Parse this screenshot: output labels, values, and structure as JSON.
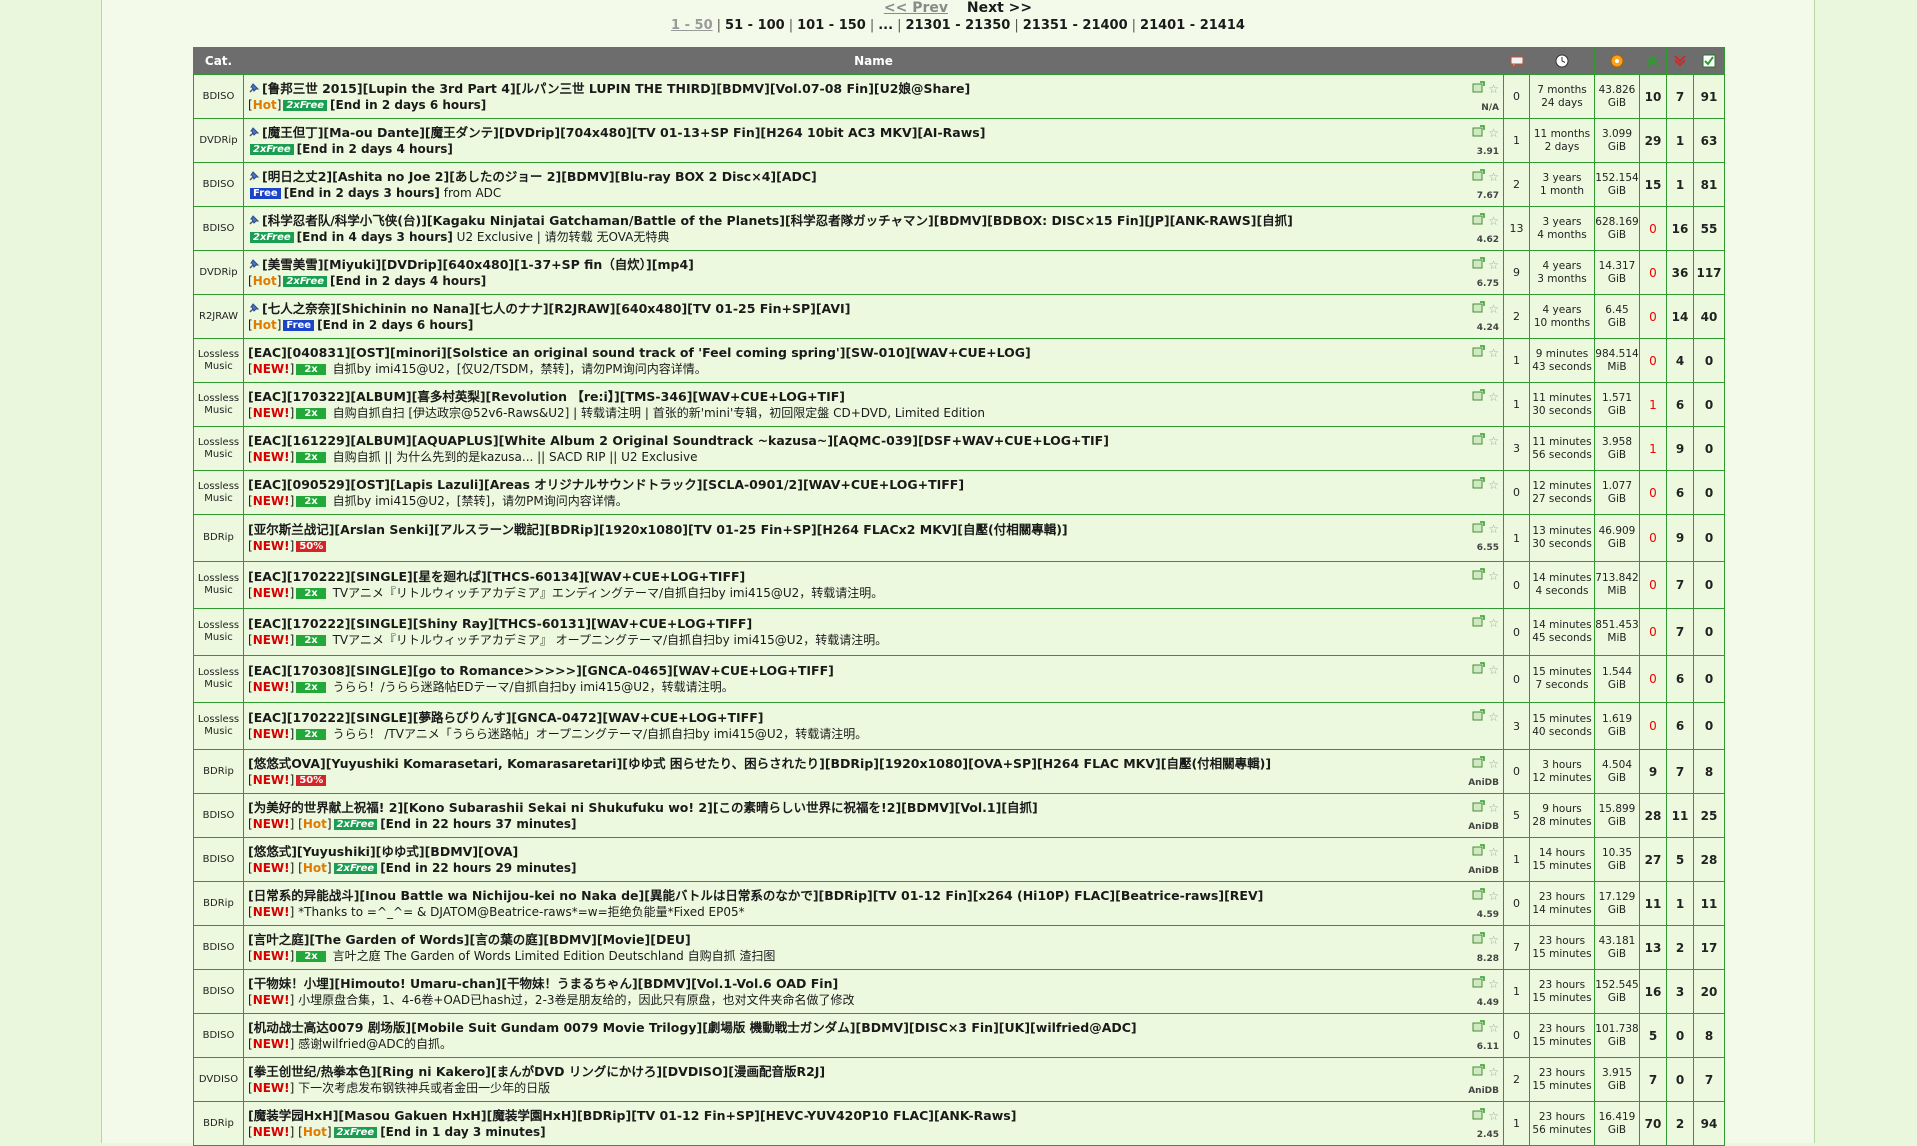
{
  "pager": {
    "prev": "<< Prev",
    "next": "Next >>",
    "pages": [
      "1 - 50",
      "51 - 100",
      "101 - 150",
      "...",
      "21301 - 21350",
      "21351 - 21400",
      "21401 - 21414"
    ]
  },
  "headers": {
    "cat": "Cat.",
    "name": "Name"
  },
  "rows": [
    {
      "cat": "BDISO",
      "sticky": true,
      "title": "[鲁邦三世 2015][Lupin the 3rd Part 4][ルパン三世 LUPIN THE THIRD][BDMV][Vol.07-08 Fin][U2娘@Share]",
      "new": false,
      "hot": true,
      "badge": "2xfree",
      "badge_text": "2xFree",
      "end": "[End in 2 days 6 hours]",
      "desc": "",
      "score": "N/A",
      "comments": "0",
      "time1": "7 months",
      "time2": "24 days",
      "size1": "43.826",
      "size2": "GiB",
      "seeders": "10",
      "leechers": "7",
      "completed": "91",
      "seed_red": false
    },
    {
      "cat": "DVDRip",
      "sticky": true,
      "title": "[魔王但丁][Ma-ou Dante][魔王ダンテ][DVDrip][704x480][TV 01-13+SP Fin][H264 10bit AC3 MKV][AI-Raws]",
      "new": false,
      "hot": false,
      "badge": "2xfree",
      "badge_text": "2xFree",
      "end": "[End in 2 days 4 hours]",
      "desc": "",
      "score": "3.91",
      "comments": "1",
      "time1": "11 months",
      "time2": "2 days",
      "size1": "3.099",
      "size2": "GiB",
      "seeders": "29",
      "leechers": "1",
      "completed": "63",
      "seed_red": false
    },
    {
      "cat": "BDISO",
      "sticky": true,
      "title": "[明日之丈2][Ashita no Joe 2][あしたのジョー 2][BDMV][Blu-ray BOX 2 Disc×4][ADC]",
      "new": false,
      "hot": false,
      "badge": "free",
      "badge_text": "Free",
      "end": "[End in 2 days 3 hours]",
      "desc": " from ADC",
      "score": "7.67",
      "comments": "2",
      "time1": "3 years",
      "time2": "1 month",
      "size1": "152.154",
      "size2": "GiB",
      "seeders": "15",
      "leechers": "1",
      "completed": "81",
      "seed_red": false
    },
    {
      "cat": "BDISO",
      "sticky": true,
      "title": "[科学忍者队/科学小飞侠(台)][Kagaku Ninjatai Gatchaman/Battle of the Planets][科学忍者隊ガッチャマン][BDMV][BDBOX: DISC×15 Fin][JP][ANK-RAWS][自抓]",
      "new": false,
      "hot": false,
      "badge": "2xfree",
      "badge_text": "2xFree",
      "end": "[End in 4 days 3 hours]",
      "desc": " U2 Exclusive | 请勿转载 无OVA无特典",
      "score": "4.62",
      "comments": "13",
      "time1": "3 years",
      "time2": "4 months",
      "size1": "628.169",
      "size2": "GiB",
      "seeders": "0",
      "leechers": "16",
      "completed": "55",
      "seed_red": true
    },
    {
      "cat": "DVDRip",
      "sticky": true,
      "title": "[美雪美雪][Miyuki][DVDrip][640x480][1-37+SP fin（自炊）][mp4]",
      "new": false,
      "hot": true,
      "badge": "2xfree",
      "badge_text": "2xFree",
      "end": "[End in 2 days 4 hours]",
      "desc": "",
      "score": "6.75",
      "comments": "9",
      "time1": "4 years",
      "time2": "3 months",
      "size1": "14.317",
      "size2": "GiB",
      "seeders": "0",
      "leechers": "36",
      "completed": "117",
      "seed_red": true
    },
    {
      "cat": "R2JRAW",
      "sticky": true,
      "title": "[七人之奈奈][Shichinin no Nana][七人のナナ][R2JRAW][640x480][TV 01-25 Fin+SP][AVI]",
      "new": false,
      "hot": true,
      "badge": "free",
      "badge_text": "Free",
      "end": "[End in 2 days 6 hours]",
      "desc": "",
      "score": "4.24",
      "comments": "2",
      "time1": "4 years",
      "time2": "10 months",
      "size1": "6.45",
      "size2": "GiB",
      "seeders": "0",
      "leechers": "14",
      "completed": "40",
      "seed_red": true
    },
    {
      "cat": "Lossless Music",
      "sticky": false,
      "title": "[EAC][040831][OST][minori][Solstice an original sound track of 'Feel coming spring'][SW-010][WAV+CUE+LOG]",
      "new": true,
      "hot": false,
      "badge": "2x",
      "badge_text": "2x",
      "end": "",
      "desc": "自抓by imi415@U2，[仅U2/TSDM，禁转]，请勿PM询问内容详情。",
      "score": "",
      "comments": "1",
      "time1": "9 minutes",
      "time2": "43 seconds",
      "size1": "984.514",
      "size2": "MiB",
      "seeders": "0",
      "leechers": "4",
      "completed": "0",
      "seed_red": true
    },
    {
      "cat": "Lossless Music",
      "sticky": false,
      "title": "[EAC][170322][ALBUM][喜多村英梨][Revolution 【re:i】][TMS-346][WAV+CUE+LOG+TIF]",
      "new": true,
      "hot": false,
      "badge": "2x",
      "badge_text": "2x",
      "end": "",
      "desc": "自购自抓自扫 [伊达政宗@52v6-Raws&U2] | 转载请注明 | 首张的新'mini'专辑，初回限定盤 CD+DVD, Limited Edition",
      "score": "",
      "comments": "1",
      "time1": "11 minutes",
      "time2": "30 seconds",
      "size1": "1.571",
      "size2": "GiB",
      "seeders": "1",
      "leechers": "6",
      "completed": "0",
      "seed_red": true
    },
    {
      "cat": "Lossless Music",
      "sticky": false,
      "title": "[EAC][161229][ALBUM][AQUAPLUS][White Album 2 Original Soundtrack ~kazusa~][AQMC-039][DSF+WAV+CUE+LOG+TIF]",
      "new": true,
      "hot": false,
      "badge": "2x",
      "badge_text": "2x",
      "end": "",
      "desc": "自购自抓 || 为什么先到的是kazusa... || SACD RIP || U2 Exclusive",
      "score": "",
      "comments": "3",
      "time1": "11 minutes",
      "time2": "56 seconds",
      "size1": "3.958",
      "size2": "GiB",
      "seeders": "1",
      "leechers": "9",
      "completed": "0",
      "seed_red": true
    },
    {
      "cat": "Lossless Music",
      "sticky": false,
      "title": "[EAC][090529][OST][Lapis Lazuli][Areas オリジナルサウンドトラック][SCLA-0901/2][WAV+CUE+LOG+TIFF]",
      "new": true,
      "hot": false,
      "badge": "2x",
      "badge_text": "2x",
      "end": "",
      "desc": "自抓by imi415@U2，[禁转]，请勿PM询问内容详情。",
      "score": "",
      "comments": "0",
      "time1": "12 minutes",
      "time2": "27 seconds",
      "size1": "1.077",
      "size2": "GiB",
      "seeders": "0",
      "leechers": "6",
      "completed": "0",
      "seed_red": true
    },
    {
      "cat": "BDRip",
      "sticky": false,
      "title": "[亚尔斯兰战记][Arslan Senki][アルスラーン戦記][BDRip][1920x1080][TV 01-25 Fin+SP][H264 FLACx2 MKV][自壓(付相關專輯)]",
      "new": true,
      "hot": false,
      "badge": "50",
      "badge_text": "50%",
      "end": "",
      "desc": "",
      "score": "6.55",
      "comments": "1",
      "time1": "13 minutes",
      "time2": "30 seconds",
      "size1": "46.909",
      "size2": "GiB",
      "seeders": "0",
      "leechers": "9",
      "completed": "0",
      "seed_red": true
    },
    {
      "cat": "Lossless Music",
      "sticky": false,
      "title": "[EAC][170222][SINGLE][星を廻れば][THCS-60134][WAV+CUE+LOG+TIFF]",
      "new": true,
      "hot": false,
      "badge": "2x",
      "badge_text": "2x",
      "end": "",
      "desc": "TVアニメ『リトルウィッチアカデミア』エンディングテーマ/自抓自扫by imi415@U2，转载请注明。",
      "score": "",
      "comments": "0",
      "time1": "14 minutes",
      "time2": "4 seconds",
      "size1": "713.842",
      "size2": "MiB",
      "seeders": "0",
      "leechers": "7",
      "completed": "0",
      "seed_red": true
    },
    {
      "cat": "Lossless Music",
      "sticky": false,
      "title": "[EAC][170222][SINGLE][Shiny Ray][THCS-60131][WAV+CUE+LOG+TIFF]",
      "new": true,
      "hot": false,
      "badge": "2x",
      "badge_text": "2x",
      "end": "",
      "desc": "TVアニメ『リトルウィッチアカデミア』 オープニングテーマ/自抓自扫by imi415@U2，转载请注明。",
      "score": "",
      "comments": "0",
      "time1": "14 minutes",
      "time2": "45 seconds",
      "size1": "851.453",
      "size2": "MiB",
      "seeders": "0",
      "leechers": "7",
      "completed": "0",
      "seed_red": true
    },
    {
      "cat": "Lossless Music",
      "sticky": false,
      "title": "[EAC][170308][SINGLE][go to Romance>>>>>][GNCA-0465][WAV+CUE+LOG+TIFF]",
      "new": true,
      "hot": false,
      "badge": "2x",
      "badge_text": "2x",
      "end": "",
      "desc": "うらら！/うらら迷路帖EDテーマ/自抓自扫by imi415@U2，转载请注明。",
      "score": "",
      "comments": "0",
      "time1": "15 minutes",
      "time2": "7 seconds",
      "size1": "1.544",
      "size2": "GiB",
      "seeders": "0",
      "leechers": "6",
      "completed": "0",
      "seed_red": true
    },
    {
      "cat": "Lossless Music",
      "sticky": false,
      "title": "[EAC][170222][SINGLE][夢路らびりんす][GNCA-0472][WAV+CUE+LOG+TIFF]",
      "new": true,
      "hot": false,
      "badge": "2x",
      "badge_text": "2x",
      "end": "",
      "desc": "うらら！ /TVアニメ「うらら迷路帖」オープニングテーマ/自抓自扫by imi415@U2，转载请注明。",
      "score": "",
      "comments": "3",
      "time1": "15 minutes",
      "time2": "40 seconds",
      "size1": "1.619",
      "size2": "GiB",
      "seeders": "0",
      "leechers": "6",
      "completed": "0",
      "seed_red": true
    },
    {
      "cat": "BDRip",
      "sticky": false,
      "title": "[悠悠式OVA][Yuyushiki Komarasetari, Komarasaretari][ゆゆ式 困らせたり、困らされたり][BDRip][1920x1080][OVA+SP][H264 FLAC MKV][自壓(付相關專輯)]",
      "new": true,
      "hot": false,
      "badge": "50",
      "badge_text": "50%",
      "end": "",
      "desc": "",
      "score": "AniDB",
      "comments": "0",
      "time1": "3 hours",
      "time2": "12 minutes",
      "size1": "4.504",
      "size2": "GiB",
      "seeders": "9",
      "leechers": "7",
      "completed": "8",
      "seed_red": false
    },
    {
      "cat": "BDISO",
      "sticky": false,
      "title": "[为美好的世界献上祝福! 2][Kono Subarashii Sekai ni Shukufuku wo! 2][この素晴らしい世界に祝福を!2][BDMV][Vol.1][自抓]",
      "new": true,
      "hot": true,
      "badge": "2xfree",
      "badge_text": "2xFree",
      "end": "[End in 22 hours 37 minutes]",
      "desc": "",
      "score": "AniDB",
      "comments": "5",
      "time1": "9 hours",
      "time2": "28 minutes",
      "size1": "15.899",
      "size2": "GiB",
      "seeders": "28",
      "leechers": "11",
      "completed": "25",
      "seed_red": false
    },
    {
      "cat": "BDISO",
      "sticky": false,
      "title": "[悠悠式][Yuyushiki][ゆゆ式][BDMV][OVA]",
      "new": true,
      "hot": true,
      "badge": "2xfree",
      "badge_text": "2xFree",
      "end": "[End in 22 hours 29 minutes]",
      "desc": "",
      "score": "AniDB",
      "comments": "1",
      "time1": "14 hours",
      "time2": "15 minutes",
      "size1": "10.35",
      "size2": "GiB",
      "seeders": "27",
      "leechers": "5",
      "completed": "28",
      "seed_red": false
    },
    {
      "cat": "BDRip",
      "sticky": false,
      "title": "[日常系的异能战斗][Inou Battle wa Nichijou-kei no Naka de][異能バトルは日常系のなかで][BDRip][TV 01-12 Fin][x264 (Hi10P) FLAC][Beatrice-raws][REV]",
      "new": true,
      "hot": false,
      "badge": "",
      "badge_text": "",
      "end": "",
      "desc": "*Thanks to =^_^= & DJATOM@Beatrice-raws*=w=拒绝负能量*Fixed EP05*",
      "score": "4.59",
      "comments": "0",
      "time1": "23 hours",
      "time2": "14 minutes",
      "size1": "17.129",
      "size2": "GiB",
      "seeders": "11",
      "leechers": "1",
      "completed": "11",
      "seed_red": false
    },
    {
      "cat": "BDISO",
      "sticky": false,
      "title": "[言叶之庭][The Garden of Words][言の葉の庭][BDMV][Movie][DEU]",
      "new": true,
      "hot": false,
      "badge": "2x",
      "badge_text": "2x",
      "end": "",
      "desc": "言叶之庭 The Garden of Words Limited Edition Deutschland 自购自抓 渣扫图",
      "score": "8.28",
      "comments": "7",
      "time1": "23 hours",
      "time2": "15 minutes",
      "size1": "43.181",
      "size2": "GiB",
      "seeders": "13",
      "leechers": "2",
      "completed": "17",
      "seed_red": false
    },
    {
      "cat": "BDISO",
      "sticky": false,
      "title": "[干物妹！小埋][Himouto! Umaru-chan][干物妹！うまるちゃん][BDMV][Vol.1-Vol.6 OAD Fin]",
      "new": true,
      "hot": false,
      "badge": "",
      "badge_text": "",
      "end": "",
      "desc": "小埋原盘合集，1、4-6卷+OAD已hash过，2-3卷是朋友给的，因此只有原盘，也对文件夹命名做了修改",
      "score": "4.49",
      "comments": "1",
      "time1": "23 hours",
      "time2": "15 minutes",
      "size1": "152.545",
      "size2": "GiB",
      "seeders": "16",
      "leechers": "3",
      "completed": "20",
      "seed_red": false
    },
    {
      "cat": "BDISO",
      "sticky": false,
      "title": "[机动战士高达0079 剧场版][Mobile Suit Gundam 0079 Movie Trilogy][劇場版 機動戦士ガンダム][BDMV][DISC×3 Fin][UK][wilfried@ADC]",
      "new": true,
      "hot": false,
      "badge": "",
      "badge_text": "",
      "end": "",
      "desc": "感谢wilfried@ADC的自抓。",
      "score": "6.11",
      "comments": "0",
      "time1": "23 hours",
      "time2": "15 minutes",
      "size1": "101.738",
      "size2": "GiB",
      "seeders": "5",
      "leechers": "0",
      "completed": "8",
      "seed_red": false
    },
    {
      "cat": "DVDISO",
      "sticky": false,
      "title": "[拳王创世纪/热拳本色][Ring ni Kakero][まんがDVD リングにかけろ][DVDISO][漫画配音版R2J]",
      "new": true,
      "hot": false,
      "badge": "",
      "badge_text": "",
      "end": "",
      "desc": "下一次考虑发布钢铁神兵或者金田一少年的日版",
      "score": "AniDB",
      "comments": "2",
      "time1": "23 hours",
      "time2": "15 minutes",
      "size1": "3.915",
      "size2": "GiB",
      "seeders": "7",
      "leechers": "0",
      "completed": "7",
      "seed_red": false
    },
    {
      "cat": "BDRip",
      "sticky": false,
      "title": "[魔装学园HxH][Masou Gakuen HxH][魔装学園HxH][BDRip][TV 01-12 Fin+SP][HEVC-YUV420P10 FLAC][ANK-Raws]",
      "new": true,
      "hot": true,
      "badge": "2xfree",
      "badge_text": "2xFree",
      "end": "[End in 1 day 3 minutes]",
      "desc": "",
      "score": "2.45",
      "comments": "1",
      "time1": "23 hours",
      "time2": "56 minutes",
      "size1": "16.419",
      "size2": "GiB",
      "seeders": "70",
      "leechers": "2",
      "completed": "94",
      "seed_red": false
    }
  ]
}
